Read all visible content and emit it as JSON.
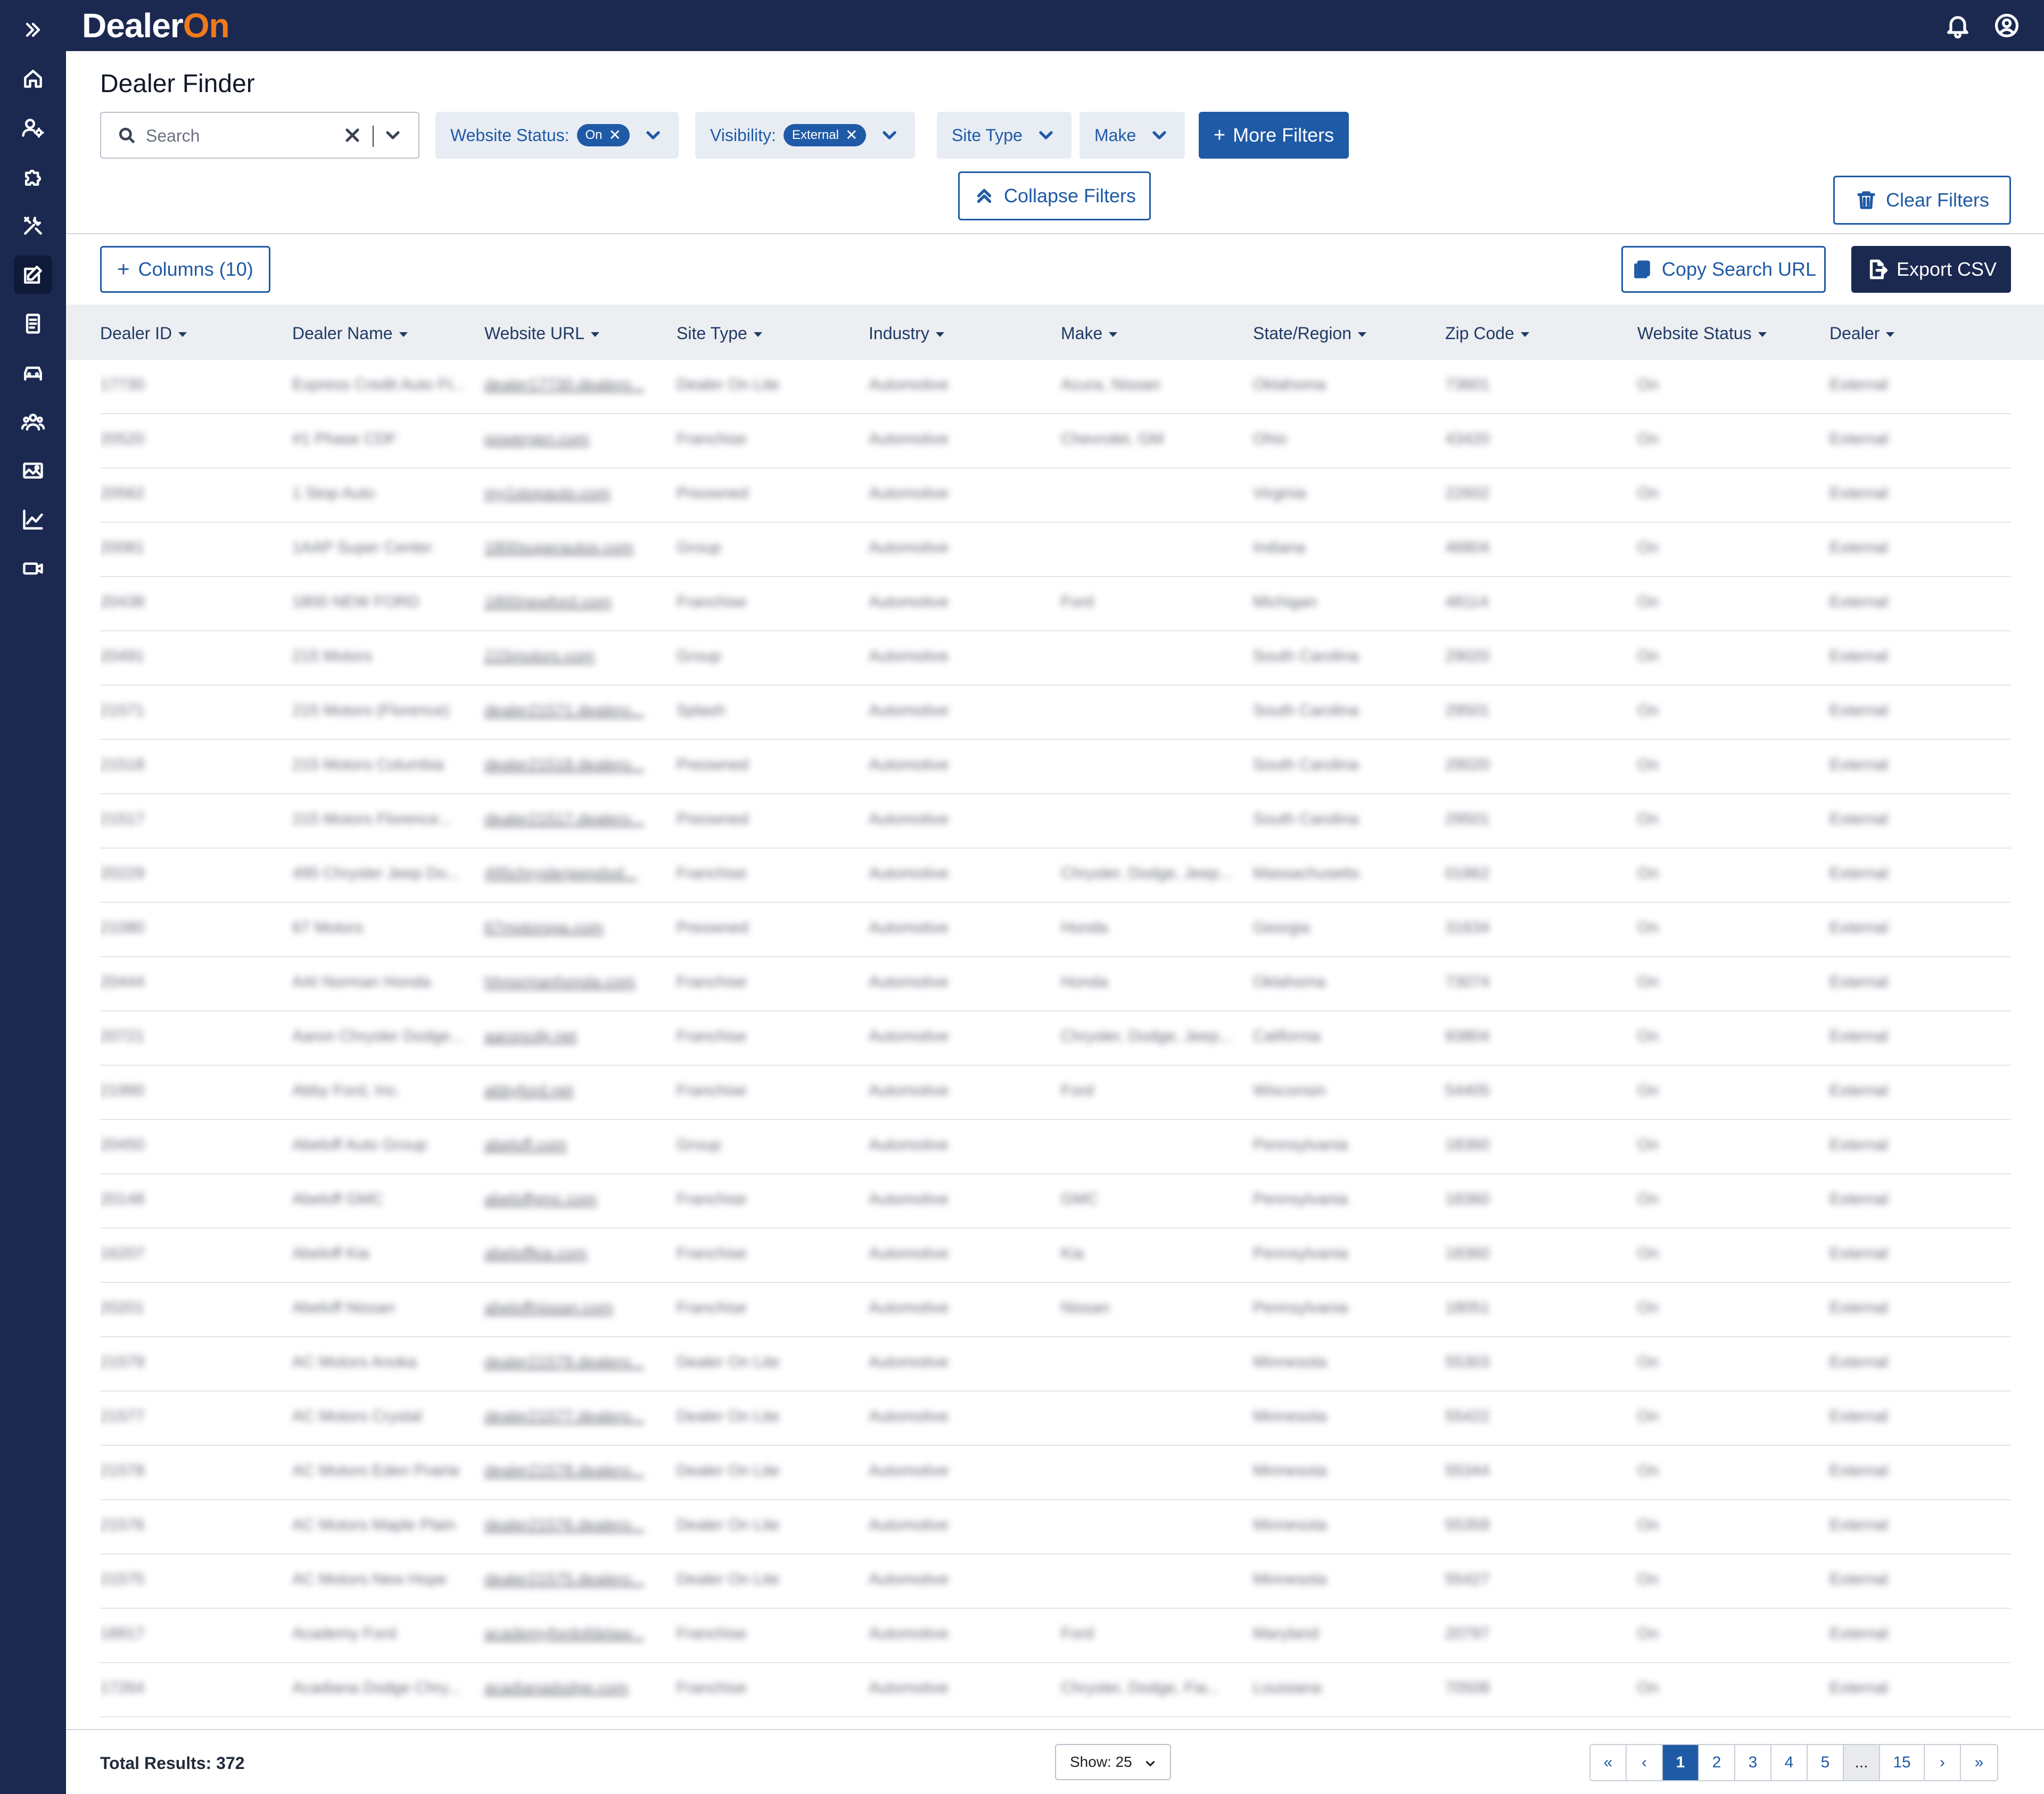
{
  "brand": {
    "logo_text": "Dealer",
    "logo_on": "On",
    "accent": "#f07a1a",
    "nav_bg": "#1b2951",
    "primary": "#1f5aa6"
  },
  "sidebar": {
    "items": [
      {
        "icon": "chevrons-right-icon",
        "name": "expand"
      },
      {
        "icon": "home-icon",
        "name": "home"
      },
      {
        "icon": "user-settings-icon",
        "name": "user-settings"
      },
      {
        "icon": "puzzle-icon",
        "name": "integrations"
      },
      {
        "icon": "tools-icon",
        "name": "tools"
      },
      {
        "icon": "edit-icon",
        "name": "dealer-finder",
        "active": true
      },
      {
        "icon": "document-icon",
        "name": "documents"
      },
      {
        "icon": "car-icon",
        "name": "vehicles"
      },
      {
        "icon": "users-icon",
        "name": "users"
      },
      {
        "icon": "image-icon",
        "name": "media"
      },
      {
        "icon": "chart-icon",
        "name": "analytics"
      },
      {
        "icon": "video-icon",
        "name": "video"
      }
    ]
  },
  "header": {
    "bell_icon": "bell-icon",
    "account_icon": "user-circle-icon"
  },
  "page": {
    "title": "Dealer Finder"
  },
  "search": {
    "placeholder": "Search",
    "value": ""
  },
  "filters": {
    "website_status": {
      "label": "Website Status:",
      "value": "On"
    },
    "visibility": {
      "label": "Visibility:",
      "value": "External"
    },
    "site_type": {
      "label": "Site Type"
    },
    "make": {
      "label": "Make"
    },
    "more_filters": "More Filters",
    "collapse_filters": "Collapse Filters",
    "clear_filters": "Clear Filters"
  },
  "toolbar": {
    "columns": "Columns (10)",
    "copy_search_url": "Copy Search URL",
    "export_csv": "Export CSV"
  },
  "table": {
    "columns": [
      "Dealer ID",
      "Dealer Name",
      "Website URL",
      "Site Type",
      "Industry",
      "Make",
      "State/Region",
      "Zip Code",
      "Website Status",
      "Dealer"
    ],
    "rows": [
      [
        "17730",
        "Express Credit Auto Ft...",
        "dealer17730.dealero...",
        "Dealer On Lite",
        "Automotive",
        "Acura, Nissan",
        "Oklahoma",
        "73601",
        "On",
        "External"
      ],
      [
        "20520",
        "#1 Phase CDF",
        "powergen.com",
        "Franchise",
        "Automotive",
        "Chevrolet, GM",
        "Ohio",
        "43420",
        "On",
        "External"
      ],
      [
        "20562",
        "1 Stop Auto",
        "my1stopauto.com",
        "Preowned",
        "Automotive",
        "",
        "Virginia",
        "22602",
        "On",
        "External"
      ],
      [
        "20081",
        "1AAP Super Center",
        "1800superautos.com",
        "Group",
        "Automotive",
        "",
        "Indiana",
        "46804",
        "On",
        "External"
      ],
      [
        "20438",
        "1800 NEW FORD",
        "1800newford.com",
        "Franchise",
        "Automotive",
        "Ford",
        "Michigan",
        "48114",
        "On",
        "External"
      ],
      [
        "20491",
        "215 Motors",
        "215motors.com",
        "Group",
        "Automotive",
        "",
        "South Carolina",
        "29020",
        "On",
        "External"
      ],
      [
        "21571",
        "215 Motors (Florence)",
        "dealer21571.dealero...",
        "Splash",
        "Automotive",
        "",
        "South Carolina",
        "29501",
        "On",
        "External"
      ],
      [
        "21518",
        "215 Motors Columbia",
        "dealer21518.dealero...",
        "Preowned",
        "Automotive",
        "",
        "South Carolina",
        "29020",
        "On",
        "External"
      ],
      [
        "21517",
        "215 Motors Florence...",
        "dealer21517.dealero...",
        "Preowned",
        "Automotive",
        "",
        "South Carolina",
        "29501",
        "On",
        "External"
      ],
      [
        "20229",
        "495 Chrysler Jeep Do...",
        "495chryslerjeepdod...",
        "Franchise",
        "Automotive",
        "Chrysler, Dodge, Jeep...",
        "Massachusetts",
        "01862",
        "On",
        "External"
      ],
      [
        "21080",
        "67 Motors",
        "67motorsga.com",
        "Preowned",
        "Automotive",
        "Honda",
        "Georgia",
        "31634",
        "On",
        "External"
      ],
      [
        "20444",
        "AAI Norman Honda",
        "hhnormanhonda.com",
        "Franchise",
        "Automotive",
        "Honda",
        "Oklahoma",
        "73074",
        "On",
        "External"
      ],
      [
        "20721",
        "Aaron Chrysler Dodge...",
        "aaroncdjr.net",
        "Franchise",
        "Automotive",
        "Chrysler, Dodge, Jeep...",
        "California",
        "93804",
        "On",
        "External"
      ],
      [
        "21990",
        "Abby Ford, Inc.",
        "abbyford.net",
        "Franchise",
        "Automotive",
        "Ford",
        "Wisconsin",
        "54405",
        "On",
        "External"
      ],
      [
        "20450",
        "Abeloff Auto Group",
        "abeloff.com",
        "Group",
        "Automotive",
        "",
        "Pennsylvania",
        "18360",
        "On",
        "External"
      ],
      [
        "20148",
        "Abeloff GMC",
        "abeloffgmc.com",
        "Franchise",
        "Automotive",
        "GMC",
        "Pennsylvania",
        "18360",
        "On",
        "External"
      ],
      [
        "16207",
        "Abeloff Kia",
        "abeloffkia.com",
        "Franchise",
        "Automotive",
        "Kia",
        "Pennsylvania",
        "18360",
        "On",
        "External"
      ],
      [
        "20201",
        "Abeloff Nissan",
        "abeloffnissan.com",
        "Franchise",
        "Automotive",
        "Nissan",
        "Pennsylvania",
        "18051",
        "On",
        "External"
      ],
      [
        "21579",
        "AC Motors Anoka",
        "dealer21579.dealero...",
        "Dealer On Lite",
        "Automotive",
        "",
        "Minnesota",
        "55303",
        "On",
        "External"
      ],
      [
        "21577",
        "AC Motors Crystal",
        "dealer21577.dealero...",
        "Dealer On Lite",
        "Automotive",
        "",
        "Minnesota",
        "55422",
        "On",
        "External"
      ],
      [
        "21578",
        "AC Motors Eden Prairie",
        "dealer21578.dealero...",
        "Dealer On Lite",
        "Automotive",
        "",
        "Minnesota",
        "55344",
        "On",
        "External"
      ],
      [
        "21576",
        "AC Motors Maple Plain",
        "dealer21576.dealero...",
        "Dealer On Lite",
        "Automotive",
        "",
        "Minnesota",
        "55359",
        "On",
        "External"
      ],
      [
        "21575",
        "AC Motors New Hope",
        "dealer21575.dealero...",
        "Dealer On Lite",
        "Automotive",
        "",
        "Minnesota",
        "55427",
        "On",
        "External"
      ],
      [
        "18917",
        "Academy Ford",
        "academyfordofdelaw...",
        "Franchise",
        "Automotive",
        "Ford",
        "Maryland",
        "20797",
        "On",
        "External"
      ],
      [
        "17264",
        "Acadiana Dodge Chry...",
        "acadianadodge.com",
        "Franchise",
        "Automotive",
        "Chrysler, Dodge, Fia...",
        "Louisiana",
        "70508",
        "On",
        "External"
      ]
    ]
  },
  "footer": {
    "total": "Total Results: 372",
    "show": "Show: 25",
    "pages": [
      "«",
      "‹",
      "1",
      "2",
      "3",
      "4",
      "5",
      "...",
      "15",
      "›",
      "»"
    ],
    "current_page": "1"
  }
}
